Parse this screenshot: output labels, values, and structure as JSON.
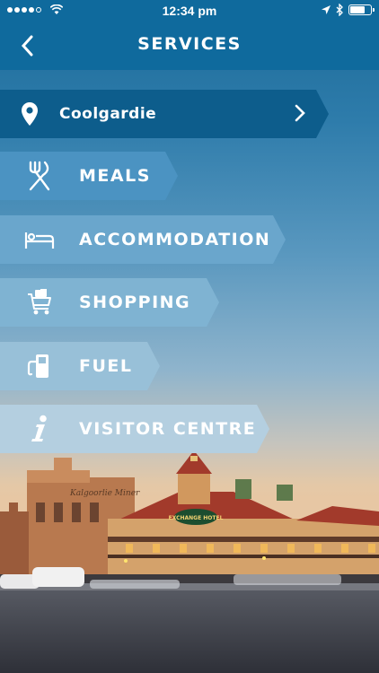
{
  "status_bar": {
    "time": "12:34 pm"
  },
  "nav": {
    "title": "SERVICES"
  },
  "location": {
    "name": "Coolgardie"
  },
  "services": [
    {
      "label": "MEALS",
      "icon": "cutlery-icon",
      "color": "#4b93c2"
    },
    {
      "label": "ACCOMMODATION",
      "icon": "bed-icon",
      "color": "#6aa6cc"
    },
    {
      "label": "SHOPPING",
      "icon": "shopping-cart-icon",
      "color": "#7fb3d2"
    },
    {
      "label": "FUEL",
      "icon": "fuel-pump-icon",
      "color": "#98c0d8"
    },
    {
      "label": "VISITOR CENTRE",
      "icon": "info-icon",
      "color": "#b4cfe0"
    }
  ],
  "colors": {
    "bar": "#0f6a9d",
    "location_tab": "#0d5d8c"
  },
  "scene_sign": {
    "top": "Kalgoorlie Miner",
    "hotel": "EXCHANGE HOTEL"
  }
}
